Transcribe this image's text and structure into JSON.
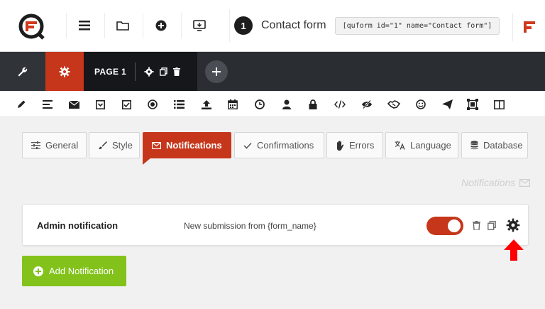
{
  "topbar": {
    "form_number": "1",
    "form_name": "Contact form",
    "shortcode": "[quform id=\"1\" name=\"Contact form\"]",
    "icons": [
      "quform-logo-icon",
      "menu-icon",
      "folder-icon",
      "add-circle-icon",
      "preview-icon",
      "brand-f-icon"
    ]
  },
  "darkbar": {
    "page_label": "PAGE 1",
    "icons": [
      "wrench-icon",
      "gear-icon",
      "gear-icon",
      "copy-icon",
      "trash-icon",
      "plus-icon"
    ]
  },
  "elements": [
    "pencil-icon",
    "paragraph-icon",
    "envelope-icon",
    "select-icon",
    "checkbox-icon",
    "radio-icon",
    "list-icon",
    "upload-icon",
    "calendar-icon",
    "clock-icon",
    "user-icon",
    "lock-icon",
    "code-icon",
    "hidden-eye-icon",
    "handshake-icon",
    "smiley-icon",
    "send-icon",
    "captcha-icon",
    "columns-icon"
  ],
  "tabs": [
    {
      "label": "General"
    },
    {
      "label": "Style"
    },
    {
      "label": "Notifications"
    },
    {
      "label": "Confirmations"
    },
    {
      "label": "Errors"
    },
    {
      "label": "Language"
    },
    {
      "label": "Database"
    }
  ],
  "section_title": "Notifications",
  "notification": {
    "name": "Admin notification",
    "subject": "New submission from {form_name}",
    "enabled": true
  },
  "add_button": "Add Notification",
  "colors": {
    "accent": "#c6361a",
    "dark": "#2a2d31",
    "green": "#82c21a",
    "arrow": "#ff0000"
  }
}
